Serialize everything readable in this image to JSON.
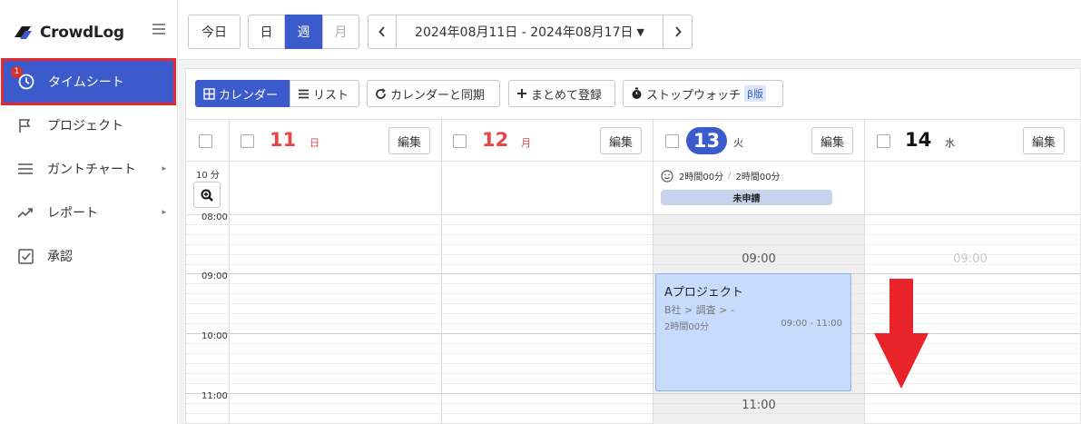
{
  "brand": {
    "name": "CrowdLog"
  },
  "sidebar": {
    "items": [
      {
        "label": "タイムシート",
        "badge": "1",
        "active": true
      },
      {
        "label": "プロジェクト"
      },
      {
        "label": "ガントチャート"
      },
      {
        "label": "レポート"
      },
      {
        "label": "承認"
      }
    ]
  },
  "topbar": {
    "today_label": "今日",
    "view_day": "日",
    "view_week": "週",
    "view_month": "月",
    "prev": "‹",
    "next": "›",
    "date_range": "2024年08月11日 - 2024年08月17日"
  },
  "toolbar": {
    "calendar": "カレンダー",
    "list": "リスト",
    "sync": "カレンダーと同期",
    "bulk": "まとめて登録",
    "stopwatch": "ストップウォッチ",
    "beta": "β版"
  },
  "calendar": {
    "interval_label": "10 分",
    "days": [
      {
        "num": "11",
        "weekday": "日",
        "edit": "編集"
      },
      {
        "num": "12",
        "weekday": "月",
        "edit": "編集"
      },
      {
        "num": "13",
        "weekday": "火",
        "edit": "編集"
      },
      {
        "num": "14",
        "weekday": "水",
        "edit": "編集"
      }
    ],
    "summary": {
      "actual": "2時間00分",
      "planned": "2時間00分",
      "status": "未申請"
    },
    "times": [
      "08:00",
      "09:00",
      "10:00",
      "11:00"
    ],
    "marker_0900": "09:00",
    "marker_0900_faint": "09:00",
    "marker_1100": "11:00",
    "event": {
      "title": "Aプロジェクト",
      "path": "B社 > 調査 > -",
      "duration": "2時間00分",
      "range": "09:00 - 11:00"
    }
  },
  "colors": {
    "accent": "#3b5bcc",
    "sunday": "#e84646",
    "highlight": "#e8282e"
  }
}
